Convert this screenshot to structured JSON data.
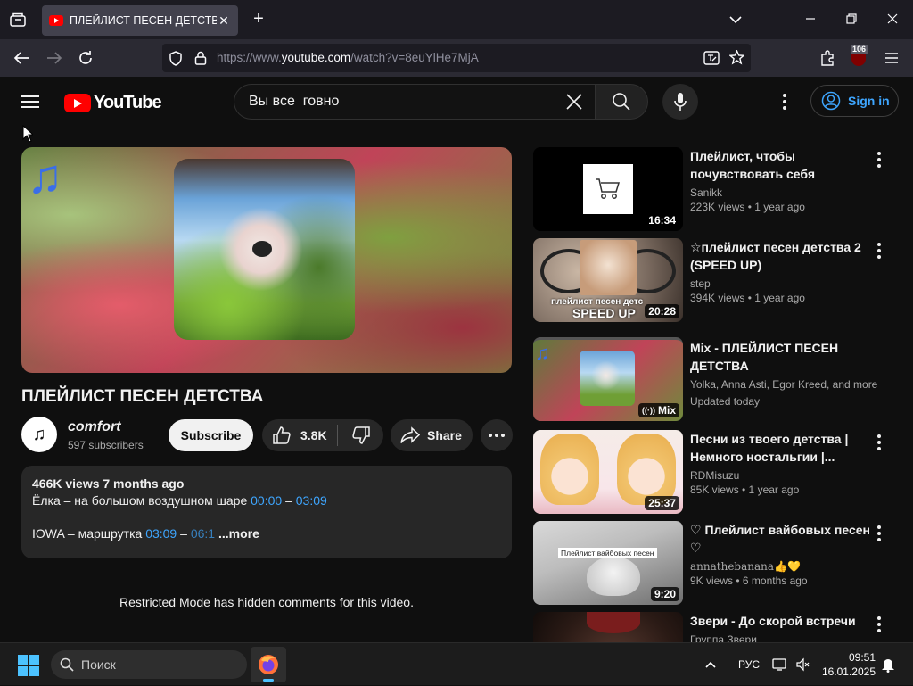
{
  "browser": {
    "tab_title": "ПЛЕЙЛИСТ ПЕСЕН ДЕТСТВА - YouTube",
    "url_prefix": "https://www.",
    "url_host": "youtube.com",
    "url_path": "/watch?v=8euYlHe7MjA",
    "extension_badge": "106"
  },
  "header": {
    "logo_text": "YouTube",
    "search_query": "Вы все  говно",
    "sign_in_label": "Sign in"
  },
  "video": {
    "title": "ПЛЕЙЛИСТ ПЕСЕН ДЕТСТВА",
    "channel_name": "comfort",
    "subscribers": "597 subscribers",
    "subscribe_label": "Subscribe",
    "likes": "3.8K",
    "share_label": "Share",
    "player_accent": "#3a6ee8"
  },
  "description": {
    "meta": "466K views  7 months ago",
    "line1_text": "Ёлка – на большом воздушном шаре ",
    "line1_ts_start": "00:00",
    "line1_dash": " – ",
    "line1_ts_end": "03:09",
    "line2_text": "IOWA – маршрутка ",
    "line2_ts_start": "03:09",
    "line2_dash": " – ",
    "line2_ts_end": "06:1",
    "more_label": "...more"
  },
  "comments": {
    "restricted_text": "Restricted Mode has hidden comments for this video."
  },
  "recommendations": [
    {
      "title": "Плейлист, чтобы почувствовать себя тележкой",
      "channel": "Sanikk",
      "meta": "223K views • 1 year ago",
      "duration": "16:34"
    },
    {
      "title": "☆плейлист песен детства 2 (SPEED UP)",
      "channel": "step",
      "meta": "394K views • 1 year ago",
      "duration": "20:28",
      "thumb_text": "плейлист песен детс",
      "thumb_text2": "SPEED UP"
    },
    {
      "title": "Mix - ПЛЕЙЛИСТ ПЕСЕН ДЕТСТВА",
      "channel": "Yolka, Anna Asti, Egor Kreed, and more",
      "meta": "Updated today",
      "duration": "Mix"
    },
    {
      "title": "Песни из твоего детства | Немного ностальгии |...",
      "channel": "RDMisuzu",
      "meta": "85K views • 1 year ago",
      "duration": "25:37"
    },
    {
      "title": "♡ Плейлист вайбовых песен ♡",
      "channel": "annathebanana👍💛",
      "meta": "9K views • 6 months ago",
      "duration": "9:20",
      "thumb_text": "Плейлист вайбовых песен"
    },
    {
      "title": "Звери - До скорой встречи",
      "channel": "Группа Звери",
      "meta": "",
      "duration": ""
    }
  ],
  "taskbar": {
    "search_label": "Поиск",
    "lang": "РУС",
    "time": "09:51",
    "date": "16.01.2025"
  },
  "colors": {
    "accent_blue": "#3ea6ff",
    "brand_red": "#ff0000",
    "windows_blue": "#4cc2ff"
  }
}
